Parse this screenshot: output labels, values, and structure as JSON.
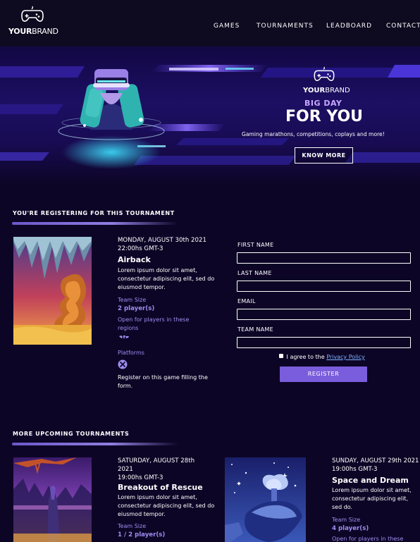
{
  "brand": {
    "logo_bold": "YOUR",
    "logo_thin": "BRAND"
  },
  "nav": [
    "GAMES",
    "TOURNAMENTS",
    "LEADBOARD",
    "CONTACT"
  ],
  "hero": {
    "logo_bold": "YOUR",
    "logo_thin": "BRAND",
    "kicker": "BIG DAY",
    "headline": "FOR YOU",
    "subtitle": "Gaming marathons, competitions, coplays and more!",
    "cta": "KNOW MORE"
  },
  "registering": {
    "section_title": "YOU'RE REGISTERING FOR THIS TOURNAMENT",
    "date": "MONDAY, AUGUST 30th 2021",
    "time": "22:00hs GMT-3",
    "title": "Airback",
    "description": "Lorem ipsum dolor sit amet, consectetur adipiscing elit, sed do eiusmod tempor.",
    "team_size_label": "Team Size",
    "team_size_value": "2 player(s)",
    "regions_text": "Open for players in these regions",
    "platforms_label": "Platforms",
    "note": "Register on this game filling the form."
  },
  "form": {
    "first_name": "FIRST NAME",
    "last_name": "LAST NAME",
    "email": "EMAIL",
    "team_name": "TEAM NAME",
    "agree_text": "I agree to the",
    "privacy_link": "Privacy Policy",
    "submit": "REGISTER"
  },
  "upcoming": {
    "section_title": "MORE UPCOMING TOURNAMENTS",
    "cards": [
      {
        "date": "SATURDAY, AUGUST 28th 2021",
        "time": "19:00hs GMT-3",
        "title": "Breakout of Rescue",
        "description": "Lorem ipsum dolor sit amet, consectetur adipiscing elit, sed do eiusmod tempor.",
        "team_size_label": "Team Size",
        "team_size_value": "1 / 2 player(s)"
      },
      {
        "date": "SUNDAY, AUGUST 29th 2021",
        "time": "19:00hs GMT-3",
        "title": "Space and Dream",
        "description": "Lorem ipsum dolor sit amet, consectetur adipiscing elit, sed do.",
        "team_size_label": "Team Size",
        "team_size_value": "4 player(s)",
        "regions_text": "Open for players in these"
      }
    ]
  },
  "colors": {
    "background": "#0d0526",
    "accent": "#7a5ddc",
    "label_purple": "#9d8ef0",
    "link": "#7fb0ff"
  }
}
